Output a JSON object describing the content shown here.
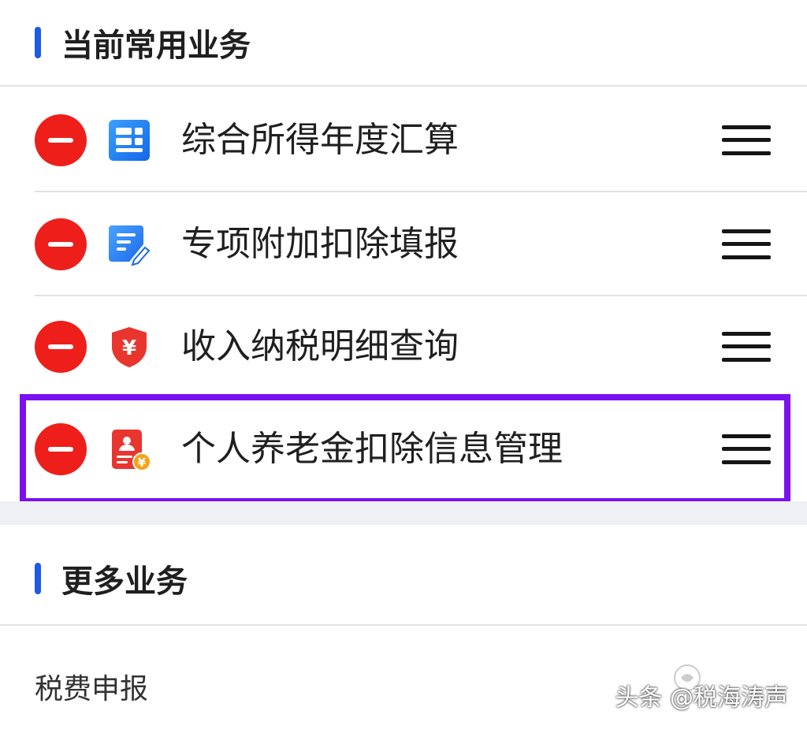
{
  "sections": {
    "current": {
      "title": "当前常用业务"
    },
    "more": {
      "title": "更多业务"
    }
  },
  "current_items": [
    {
      "label": "综合所得年度汇算",
      "icon": "grid-icon",
      "icon_color": "#1d7ff0"
    },
    {
      "label": "专项附加扣除填报",
      "icon": "form-edit-icon",
      "icon_color": "#2b7af0"
    },
    {
      "label": "收入纳税明细查询",
      "icon": "shield-yen-icon",
      "icon_color": "#e8362f"
    },
    {
      "label": "个人养老金扣除信息管理",
      "icon": "id-card-yen-icon",
      "icon_color": "#e8362f"
    }
  ],
  "more_items": [
    {
      "label": "税费申报"
    }
  ],
  "watermark": {
    "text": "头条 @税海涛声"
  },
  "colors": {
    "accent_bar": "#1d5be6",
    "remove_red": "#ee1f1a",
    "highlight_purple": "#7b10f0"
  }
}
